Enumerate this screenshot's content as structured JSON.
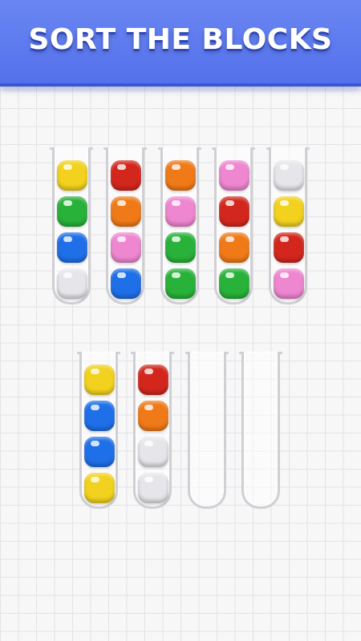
{
  "banner": {
    "title": "SORT THE BLOCKS"
  },
  "colors": {
    "yellow": "#f2d21e",
    "green": "#28b23a",
    "blue": "#1f6fe8",
    "white": "#e6e6ea",
    "red": "#d3271d",
    "orange": "#f07a18",
    "pink": "#ee86d0",
    "banner": "#5a76ee"
  },
  "tubes": [
    {
      "row": 1,
      "blocks_top_to_bottom": [
        "yellow",
        "green",
        "blue",
        "white"
      ]
    },
    {
      "row": 1,
      "blocks_top_to_bottom": [
        "red",
        "orange",
        "pink",
        "blue"
      ]
    },
    {
      "row": 1,
      "blocks_top_to_bottom": [
        "orange",
        "pink",
        "green",
        "green"
      ]
    },
    {
      "row": 1,
      "blocks_top_to_bottom": [
        "pink",
        "red",
        "orange",
        "green"
      ]
    },
    {
      "row": 1,
      "blocks_top_to_bottom": [
        "white",
        "yellow",
        "red",
        "pink"
      ]
    },
    {
      "row": 2,
      "blocks_top_to_bottom": [
        "yellow",
        "blue",
        "blue",
        "yellow"
      ]
    },
    {
      "row": 2,
      "blocks_top_to_bottom": [
        "red",
        "orange",
        "white",
        "white"
      ]
    },
    {
      "row": 2,
      "blocks_top_to_bottom": []
    },
    {
      "row": 2,
      "blocks_top_to_bottom": []
    }
  ]
}
